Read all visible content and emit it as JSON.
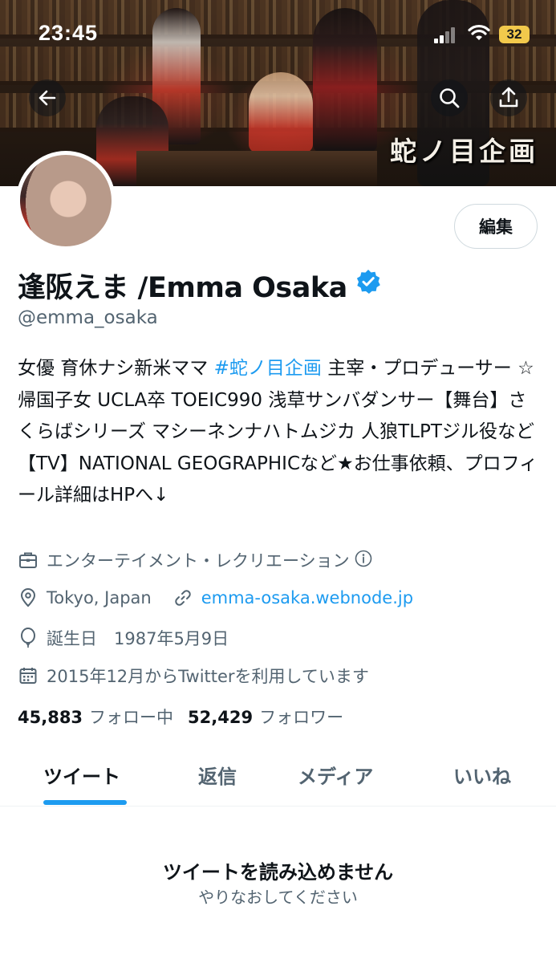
{
  "status_bar": {
    "time": "23:45",
    "battery": "32"
  },
  "banner": {
    "logo_text": "蛇ノ目企画"
  },
  "profile": {
    "edit_label": "編集",
    "display_name": "逢阪えま /Emma Osaka",
    "handle": "@emma_osaka",
    "bio_part1": "女優 育休ナシ新米ママ ",
    "bio_hashtag": "#蛇ノ目企画",
    "bio_part2": " 主宰・プロデューサー ☆帰国子女 UCLA卒 TOEIC990 浅草サンバダンサー【舞台】さくらばシリーズ マシーネンナハトムジカ 人狼TLPTジル役など【TV】NATIONAL GEOGRAPHICなど★お仕事依頼、プロフィール詳細はHPへ↓",
    "category": "エンターテイメント・レクリエーション",
    "location": "Tokyo, Japan",
    "website": "emma-osaka.webnode.jp",
    "birthday": "誕生日　1987年5月9日",
    "joined": "2015年12月からTwitterを利用しています",
    "following_count": "45,883",
    "following_label": "フォロー中",
    "followers_count": "52,429",
    "followers_label": "フォロワー"
  },
  "tabs": [
    {
      "label": "ツイート",
      "active": true
    },
    {
      "label": "返信",
      "active": false
    },
    {
      "label": "メディア",
      "active": false
    },
    {
      "label": "いいね",
      "active": false
    }
  ],
  "empty_state": {
    "title": "ツイートを読み込めません",
    "subtitle": "やりなおしてください"
  },
  "colors": {
    "accent": "#1d9bf0",
    "secondary_text": "#536471",
    "primary_text": "#0f1419"
  }
}
